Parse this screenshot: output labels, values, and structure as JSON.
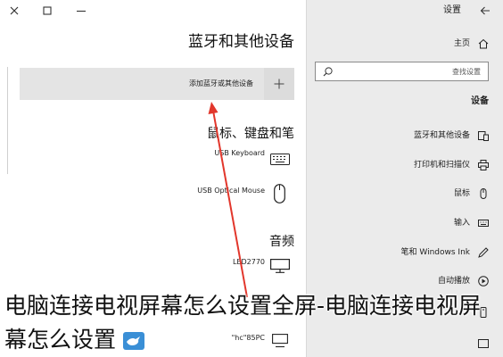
{
  "window": {
    "title": "设置",
    "controls": [
      "close-icon",
      "maximize-icon",
      "minimize-icon"
    ],
    "back_icon": "back-arrow-icon"
  },
  "sidebar": {
    "home_label": "主页",
    "home_icon": "home-icon",
    "search_placeholder": "查找设置",
    "search_icon": "search-icon",
    "section_heading": "设备",
    "items": [
      {
        "label": "蓝牙和其他设备",
        "icon": "bluetooth-devices-icon"
      },
      {
        "label": "打印机和扫描仪",
        "icon": "printer-icon"
      },
      {
        "label": "鼠标",
        "icon": "mouse-icon"
      },
      {
        "label": "输入",
        "icon": "keyboard-icon"
      },
      {
        "label": "笔和 Windows Ink",
        "icon": "pen-icon"
      },
      {
        "label": "自动播放",
        "icon": "autoplay-icon"
      }
    ]
  },
  "main": {
    "title": "蓝牙和其他设备",
    "add_device_label": "添加蓝牙或其他设备",
    "add_icon": "plus-icon",
    "sections": [
      {
        "heading": "鼠标、键盘和笔",
        "devices": [
          {
            "name": "USB Keyboard",
            "icon": "keyboard-icon"
          },
          {
            "name": "USB Optical Mouse",
            "icon": "mouse-icon"
          }
        ]
      },
      {
        "heading": "音频",
        "devices": [
          {
            "name": "LED2770",
            "icon": "monitor-icon"
          },
          {
            "name": "\"hc\"85PC",
            "icon": "device-icon"
          }
        ]
      }
    ]
  },
  "caption": {
    "lines": [
      "电脑连接电视屏幕怎么设置全屏-电脑连接电视屏",
      "幕怎么设置"
    ],
    "logo_icon": "bird-logo-icon"
  },
  "colors": {
    "sidebar_bg": "#ebebeb",
    "button_bg": "#e4e4e4",
    "arrow": "#e2372c",
    "logo": "#3a8fd6"
  }
}
